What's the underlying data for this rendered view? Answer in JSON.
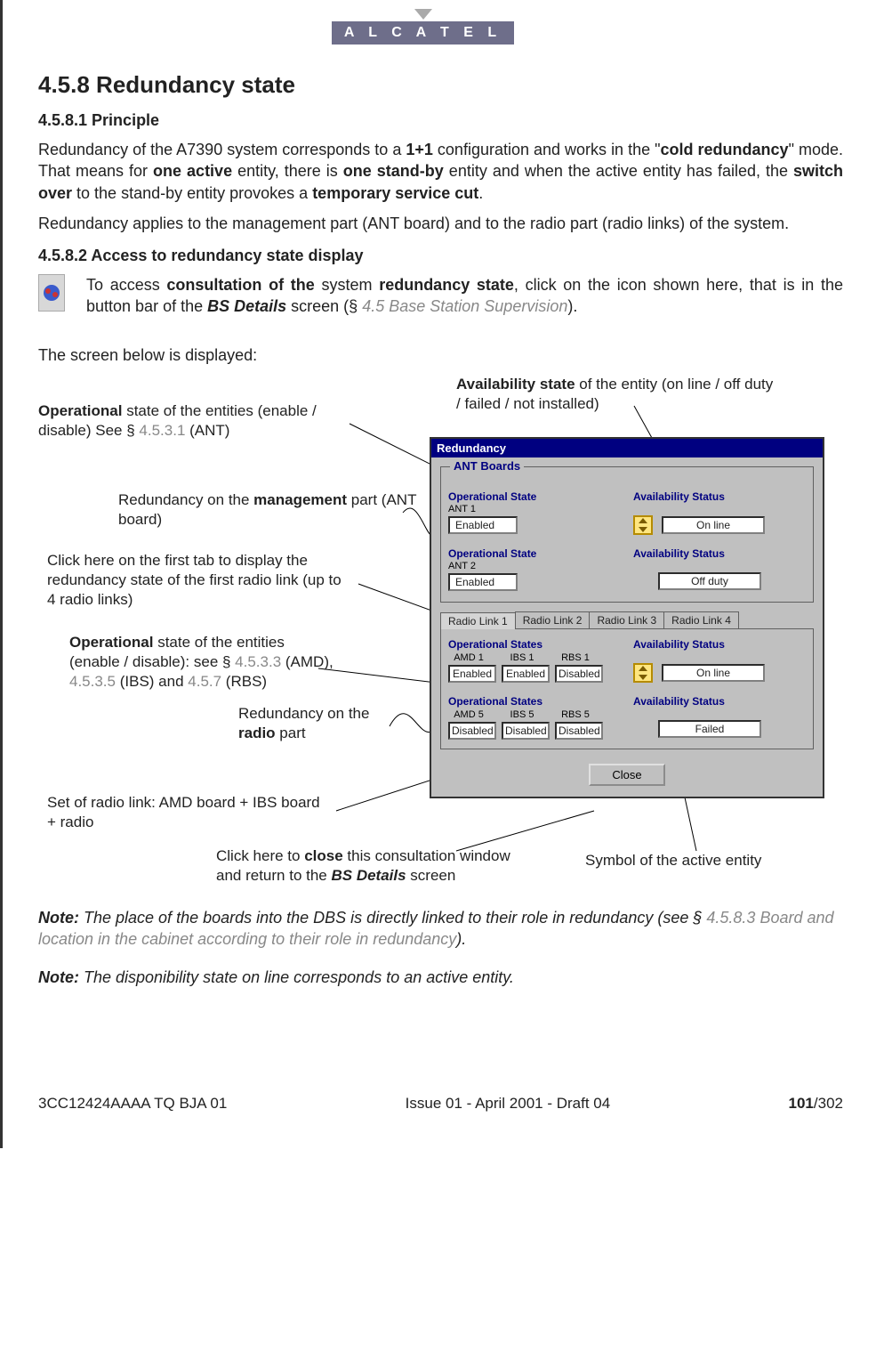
{
  "brand": "A L C A T E L",
  "h2": "4.5.8    Redundancy state",
  "h3a": "4.5.8.1    Principle",
  "p1a": "Redundancy of the A7390 system corresponds to a ",
  "p1b": "1+1",
  "p1c": " configuration and works in the \"",
  "p1d": "cold redundancy",
  "p1e": "\" mode. That means for ",
  "p1f": "one active",
  "p1g": " entity, there is ",
  "p1h": "one stand-by",
  "p1i": " entity and when the active entity has failed, the ",
  "p1j": "switch over",
  "p1k": " to the stand-by entity provokes a ",
  "p1l": "temporary service cut",
  "p1m": ".",
  "p2": "Redundancy applies to the management part (ANT board) and to the radio part (radio links) of the system.",
  "h3b": "4.5.8.2    Access to redundancy state display",
  "p3a": "To access ",
  "p3b": "consultation of the",
  "p3c": " system ",
  "p3d": "redundancy state",
  "p3e": ", click on the icon shown here, that is in the button bar of the ",
  "p3f": "BS Details",
  "p3g": " screen (§ ",
  "p3h": "4.5 Base Station Supervision",
  "p3i": ").",
  "p4": "The screen below is displayed:",
  "callouts": {
    "c1a": "Availability state",
    "c1b": " of the entity (on line / off duty / failed / not installed)",
    "c2a": "Operational",
    "c2b": " state of the entities (enable / disable)  See § ",
    "c2c": "4.5.3.1",
    "c2d": " (ANT)",
    "c3a": "Redundancy on the ",
    "c3b": "management",
    "c3c": " part (ANT board)",
    "c4": "Click here on the first tab to display the redundancy state of the first radio link (up to 4 radio links)",
    "c5a": "Operational",
    "c5b": " state of the entities (enable / disable): see § ",
    "c5c": "4.5.3.3",
    "c5d": "  (AMD), ",
    "c5e": "4.5.3.5",
    "c5f": " (IBS) and ",
    "c5g": "4.5.7",
    "c5h": "  (RBS)",
    "c6a": "Redundancy on the ",
    "c6b": "radio",
    "c6c": " part",
    "c7": "Set of radio link: AMD board + IBS board + radio",
    "c8a": "Click here to ",
    "c8b": "close",
    "c8c": " this consultation window and return to the ",
    "c8d": "BS Details",
    "c8e": " screen",
    "c9": "Symbol of the active entity"
  },
  "win": {
    "title": "Redundancy",
    "ant_group": "ANT Boards",
    "op_state": "Operational State",
    "avail": "Availability Status",
    "ant1": "ANT 1",
    "ant1_state": "Enabled",
    "ant1_avail": "On line",
    "ant2": "ANT 2",
    "ant2_state": "Enabled",
    "ant2_avail": "Off duty",
    "tabs": [
      "Radio Link 1",
      "Radio Link 2",
      "Radio Link 3",
      "Radio Link 4"
    ],
    "op_states": "Operational States",
    "row1": {
      "c": [
        "AMD 1",
        "IBS 1",
        "RBS 1"
      ],
      "v": [
        "Enabled",
        "Enabled",
        "Disabled"
      ],
      "avail": "On line"
    },
    "row2": {
      "c": [
        "AMD 5",
        "IBS 5",
        "RBS 5"
      ],
      "v": [
        "Disabled",
        "Disabled",
        "Disabled"
      ],
      "avail": "Failed"
    },
    "close": "Close"
  },
  "note1_lead": "Note:  ",
  "note1a": "The place of the boards into the DBS is directly linked to their role in redundancy (see § ",
  "note1b": "4.5.8.3 Board and location in the cabinet according to their role in redundancy",
  "note1c": ").",
  "note2_lead": "Note:  ",
  "note2": "The disponibility state on line corresponds to an active entity.",
  "footer": {
    "left": "3CC12424AAAA TQ BJA 01",
    "mid": "Issue 01 - April 2001 - Draft 04",
    "pnum": "101",
    "ptot": "/302"
  }
}
